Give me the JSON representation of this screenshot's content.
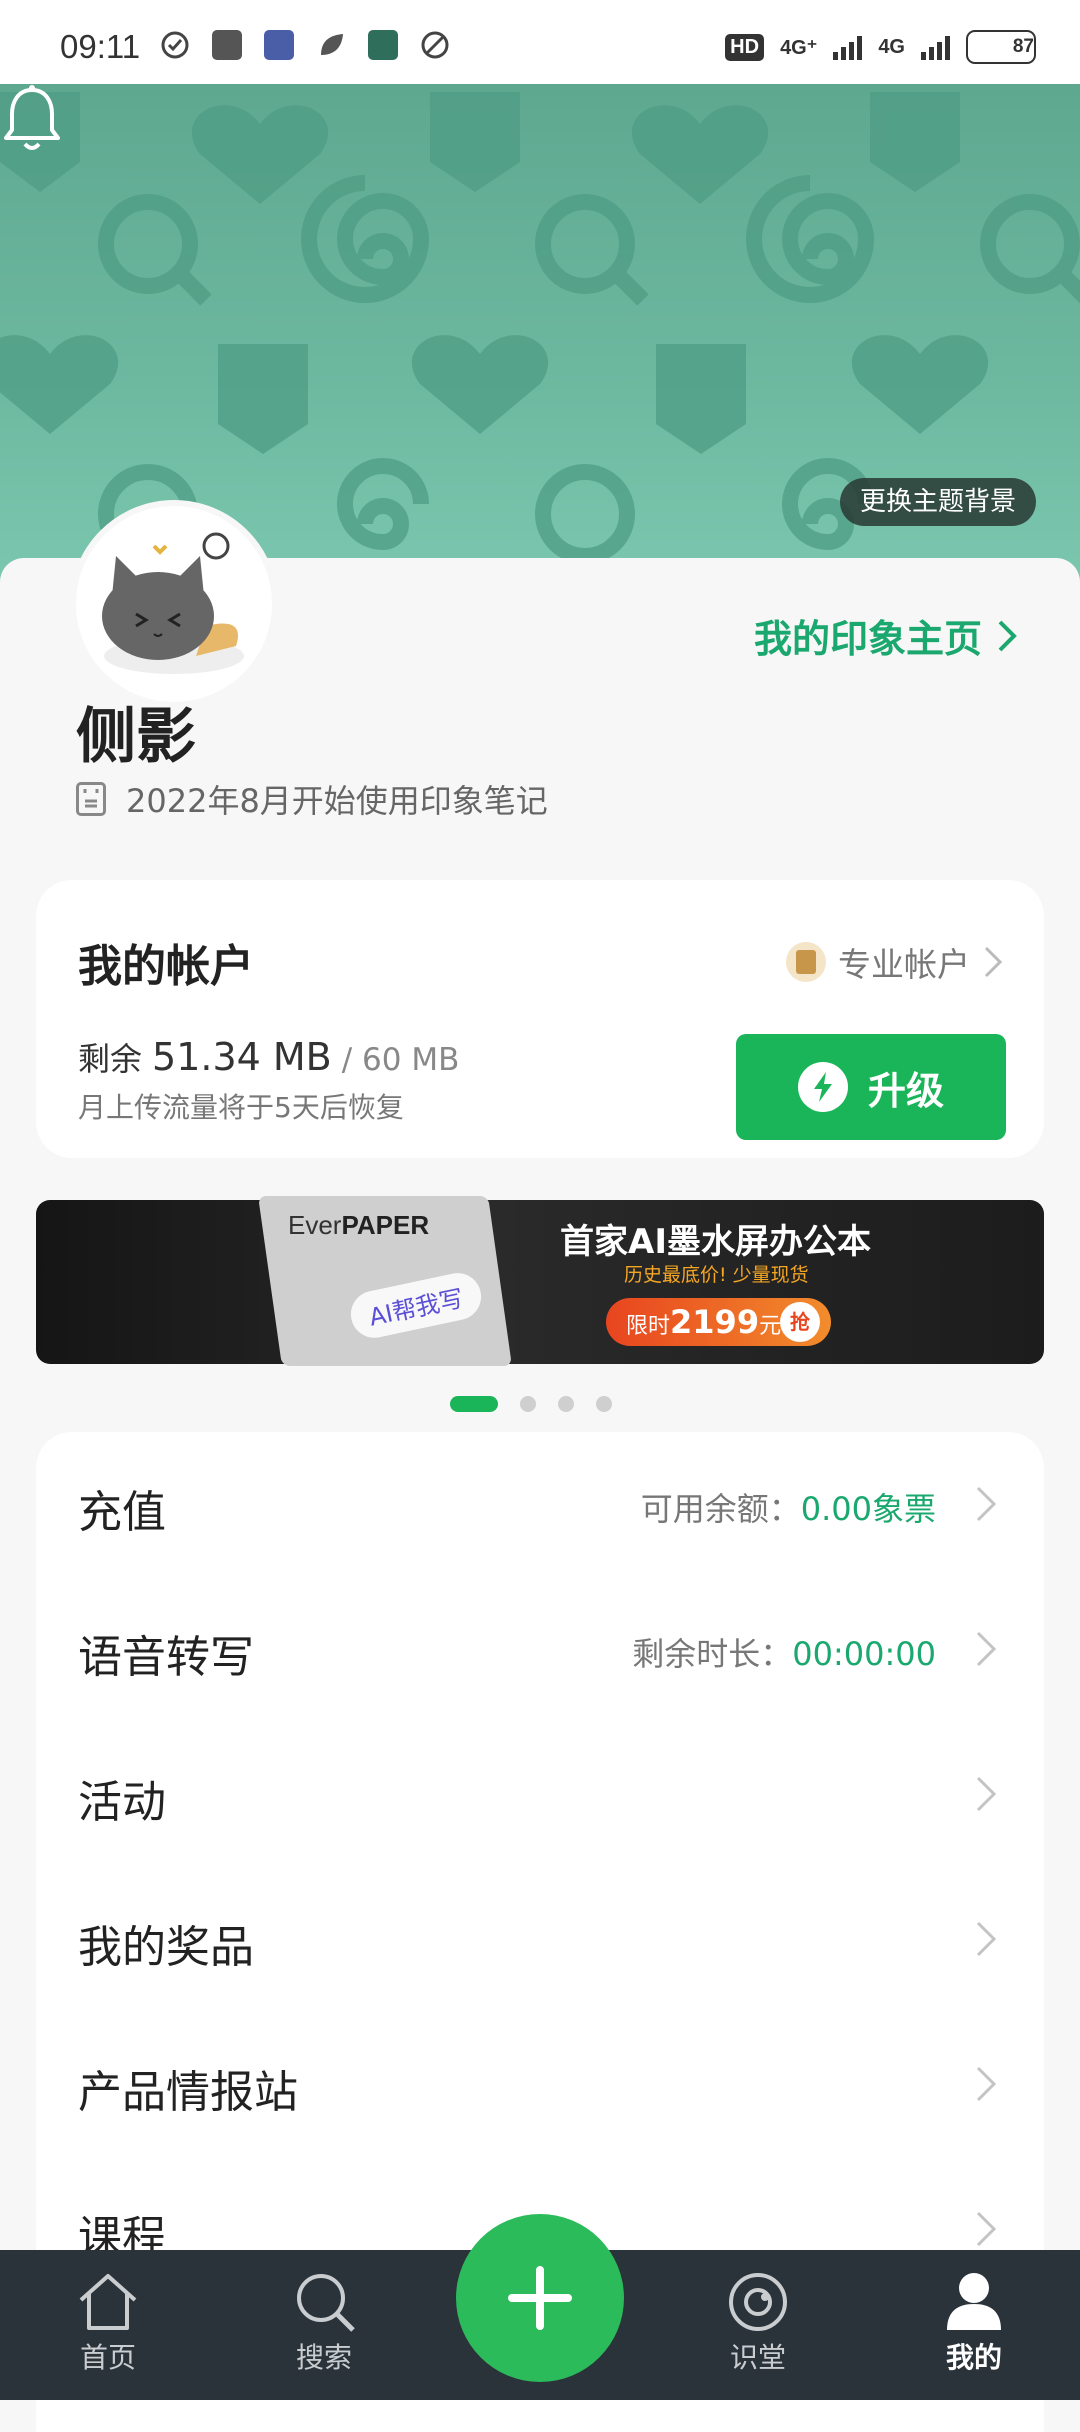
{
  "status_bar": {
    "time": "09:11",
    "network_1": "4G⁺",
    "network_2": "4G",
    "hd_label": "HD",
    "battery": "87",
    "battery_level": 0.87
  },
  "header": {
    "theme_button": "更换主题背景",
    "homepage_link": "我的印象主页"
  },
  "profile": {
    "username": "侧影",
    "since": "2022年8月开始使用印象笔记"
  },
  "account": {
    "title": "我的帐户",
    "type_label": "专业帐户",
    "remain_prefix": "剩余",
    "remain_value": "51.34 MB",
    "remain_total": "/ 60 MB",
    "reset_note": "月上传流量将于5天后恢复",
    "upgrade_label": "升级"
  },
  "banner": {
    "brand_ever": "Ever",
    "brand_paper": "PAPER",
    "ai_chip": "AI帮我写",
    "title": "首家AI墨水屏办公本",
    "subtitle": "历史最底价! 少量现货",
    "price_prefix": "限时",
    "price_value": "2199",
    "price_unit": "元",
    "grab": "抢",
    "slide_count": 4,
    "active_slide": 1
  },
  "menu": {
    "items": [
      {
        "label": "充值",
        "note_label": "可用余额：",
        "note_value": "0.00象票"
      },
      {
        "label": "语音转写",
        "note_label": "剩余时长：",
        "note_value": "00:00:00"
      },
      {
        "label": "活动"
      },
      {
        "label": "我的奖品"
      },
      {
        "label": "产品情报站"
      },
      {
        "label": "课程"
      }
    ]
  },
  "nav": {
    "home": "首页",
    "search": "搜索",
    "learn": "识堂",
    "me": "我的"
  },
  "colors": {
    "accent": "#1bb559",
    "link": "#1aa86f",
    "hero": "#6cb89f",
    "navbar": "#2b333a"
  }
}
